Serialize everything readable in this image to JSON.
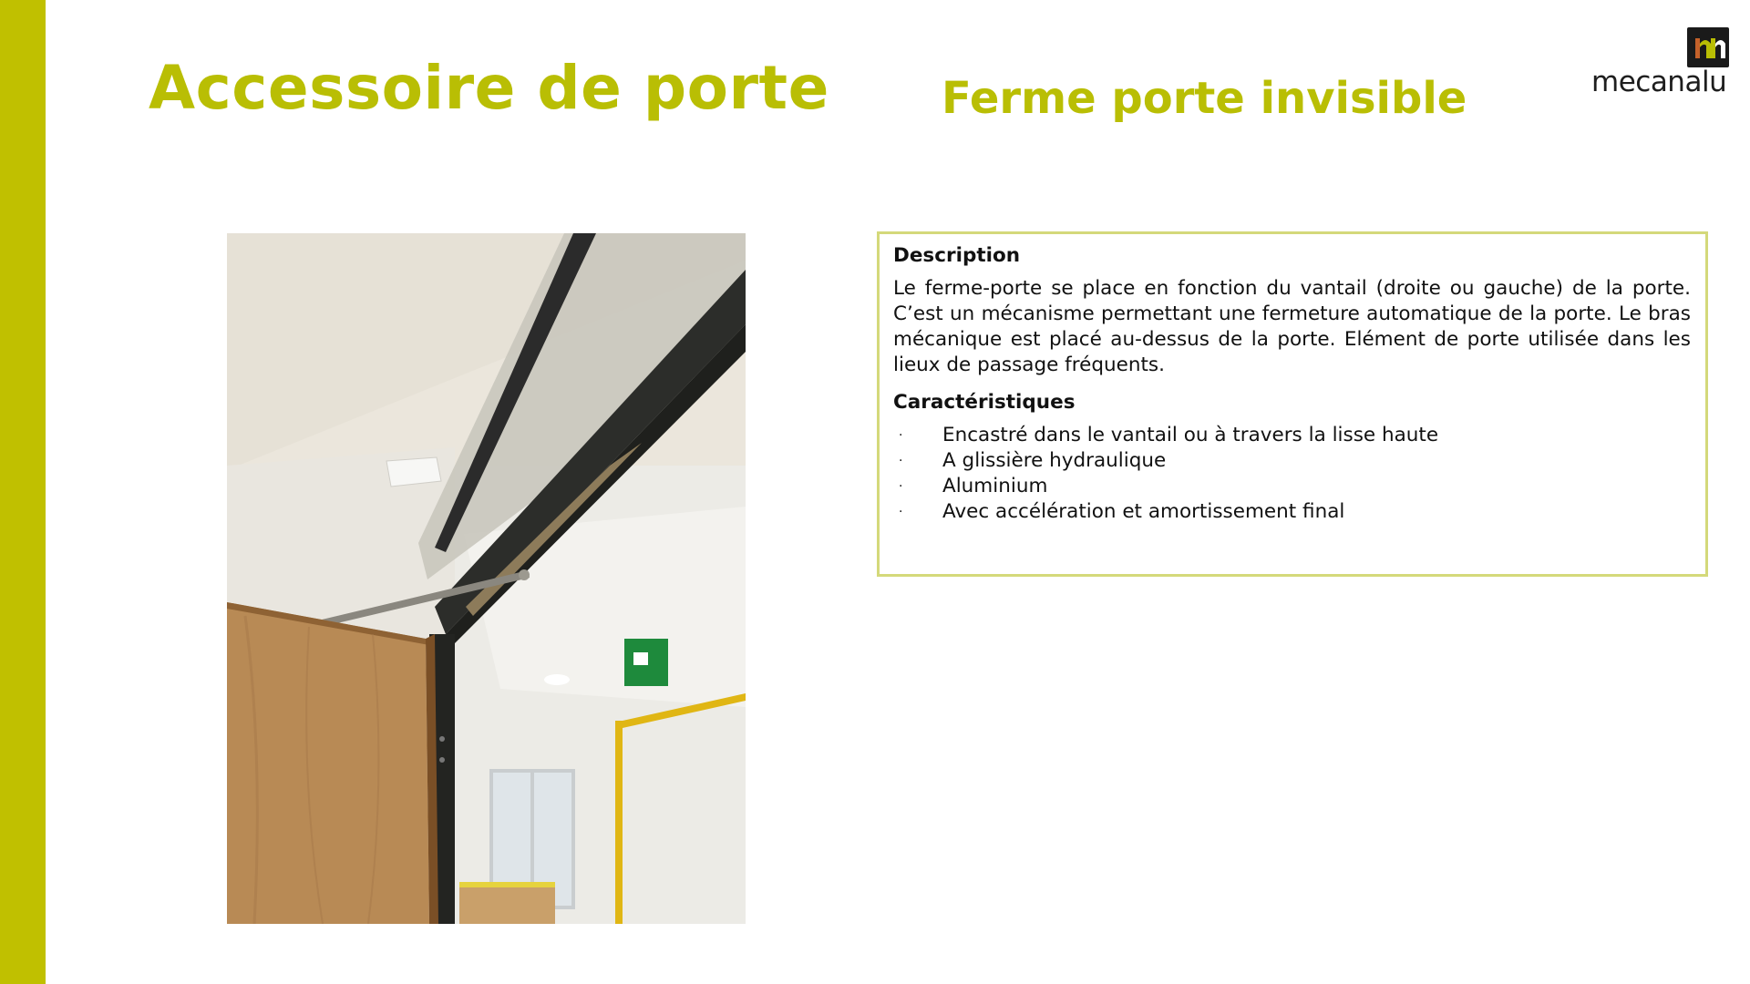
{
  "header": {
    "title": "Accessoire de porte",
    "subtitle": "Ferme porte invisible"
  },
  "logo": {
    "wordmark": "mecanalu",
    "icon": "mecanalu-logo-icon",
    "colors": {
      "mark_bg": "#1a1a1a",
      "brown": "#c4612a",
      "olive": "#b9be04"
    }
  },
  "photo": {
    "icon": "door-closer-photo"
  },
  "info": {
    "description_heading": "Description",
    "description_text": "Le ferme-porte se place en fonction du vantail (droite ou gauche) de la porte. C’est un mécanisme permettant une fermeture automatique de la porte. Le bras mécanique est placé au-dessus de la porte. Elément de porte utilisée dans les lieux de passage fréquents.",
    "features_heading": "Caractéristiques",
    "bullet": "·",
    "features": [
      "Encastré dans le vantail ou à travers la lisse haute",
      "A glissière hydraulique",
      "Aluminium",
      "Avec accélération et amortissement final"
    ]
  },
  "theme": {
    "accent": "#b9be04",
    "side_bar": "#c0c000",
    "box_border": "#d4d97a"
  }
}
